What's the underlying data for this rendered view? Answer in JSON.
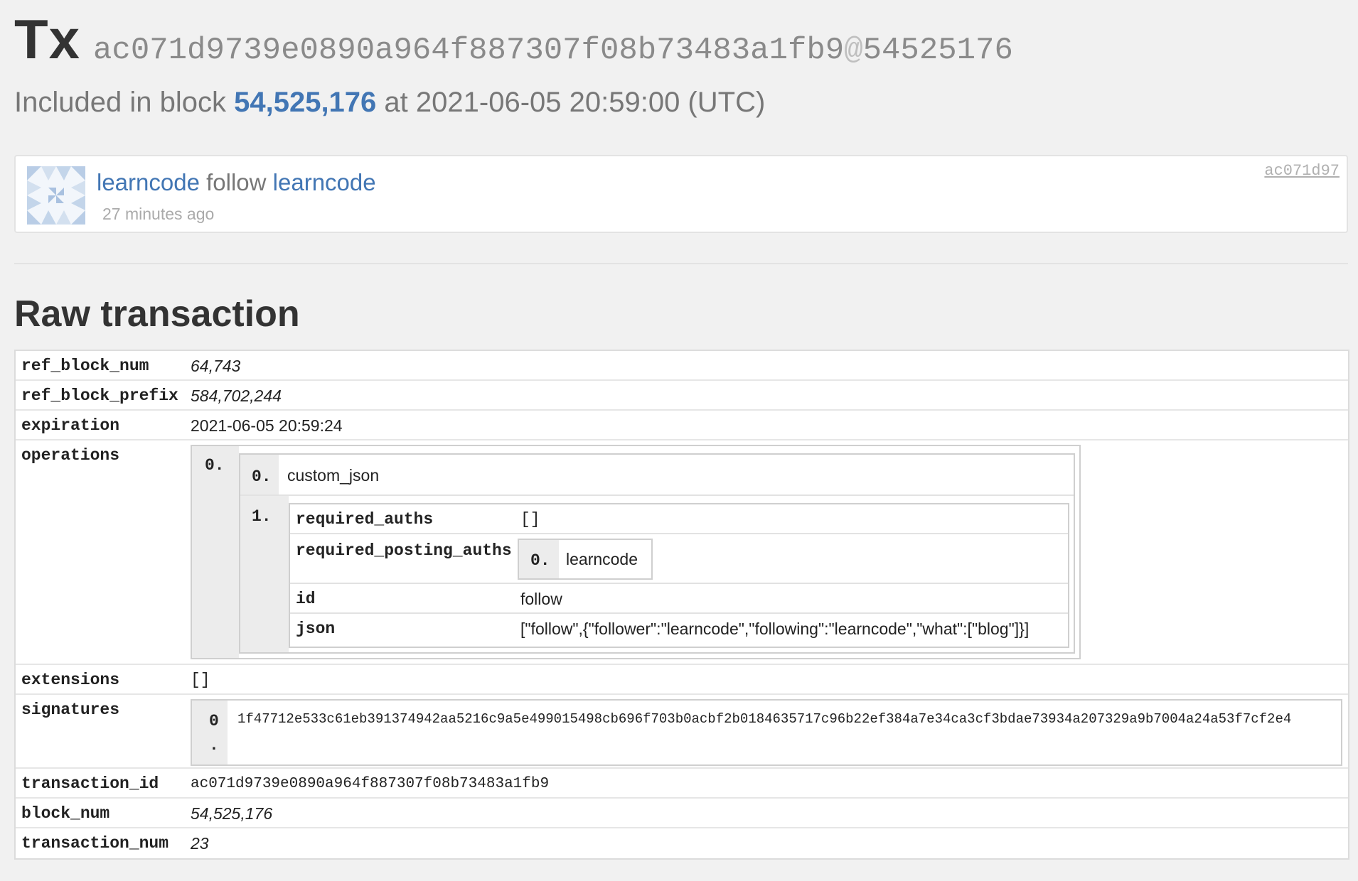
{
  "header": {
    "tx_label": "Tx",
    "tx_hash": "ac071d9739e0890a964f887307f08b73483a1fb9",
    "at_sign": "@",
    "block_ref": "54525176",
    "included_prefix": "Included in block",
    "block_number": "54,525,176",
    "included_suffix": "at 2021-06-05 20:59:00 (UTC)"
  },
  "operation_card": {
    "actor": "learncode",
    "verb": "follow",
    "target": "learncode",
    "time_ago": "27 minutes ago",
    "short_hash": "ac071d97"
  },
  "raw": {
    "title": "Raw transaction",
    "ref_block_num": {
      "key": "ref_block_num",
      "value": "64,743"
    },
    "ref_block_prefix": {
      "key": "ref_block_prefix",
      "value": "584,702,244"
    },
    "expiration": {
      "key": "expiration",
      "value": "2021-06-05 20:59:24"
    },
    "operations": {
      "key": "operations",
      "outer_index": "0.",
      "type_index": "0.",
      "type": "custom_json",
      "body_index": "1.",
      "fields": {
        "required_auths": {
          "key": "required_auths",
          "value": "[]"
        },
        "required_posting_auths": {
          "key": "required_posting_auths",
          "index": "0.",
          "value": "learncode"
        },
        "id": {
          "key": "id",
          "value": "follow"
        },
        "json": {
          "key": "json",
          "value": "[\"follow\",{\"follower\":\"learncode\",\"following\":\"learncode\",\"what\":[\"blog\"]}]"
        }
      }
    },
    "extensions": {
      "key": "extensions",
      "value": "[]"
    },
    "signatures": {
      "key": "signatures",
      "index_digit": "0",
      "index_dot": ".",
      "value": "1f47712e533c61eb391374942aa5216c9a5e499015498cb696f703b0acbf2b0184635717c96b22ef384a7e34ca3cf3bdae73934a207329a9b7004a24a53f7cf2e4"
    },
    "transaction_id": {
      "key": "transaction_id",
      "value": "ac071d9739e0890a964f887307f08b73483a1fb9"
    },
    "block_num": {
      "key": "block_num",
      "value": "54,525,176"
    },
    "transaction_num": {
      "key": "transaction_num",
      "value": "23"
    }
  },
  "colors": {
    "link": "#4276b4",
    "background": "#f1f1f1",
    "muted": "#8a8a8a"
  },
  "icons": {
    "avatar": "identicon-avatar"
  }
}
